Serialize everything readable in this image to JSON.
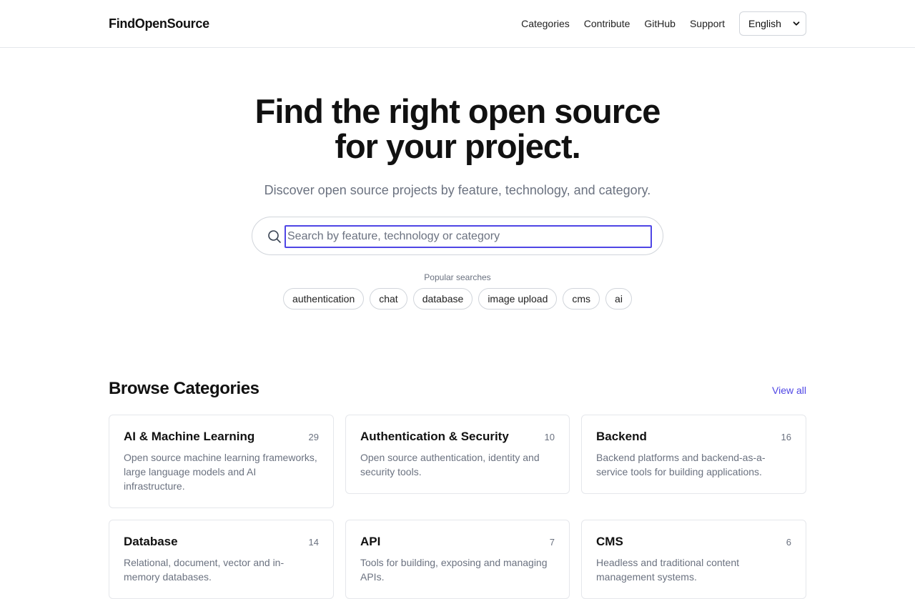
{
  "header": {
    "logo": "FindOpenSource",
    "nav": [
      "Categories",
      "Contribute",
      "GitHub",
      "Support"
    ],
    "language": "English"
  },
  "hero": {
    "title_line1": "Find the right open source",
    "title_line2": "for your project.",
    "subtitle": "Discover open source projects by feature, technology, and category."
  },
  "search": {
    "placeholder": "Search by feature, technology or category",
    "value": ""
  },
  "popular": {
    "label": "Popular searches",
    "chips": [
      "authentication",
      "chat",
      "database",
      "image upload",
      "cms",
      "ai"
    ]
  },
  "categories": {
    "title": "Browse Categories",
    "view_all": "View all",
    "items": [
      {
        "name": "AI & Machine Learning",
        "count": "29",
        "desc": "Open source machine learning frameworks, large language models and AI infrastructure."
      },
      {
        "name": "Authentication & Security",
        "count": "10",
        "desc": "Open source authentication, identity and security tools."
      },
      {
        "name": "Backend",
        "count": "16",
        "desc": "Backend platforms and backend-as-a-service tools for building applications."
      },
      {
        "name": "Database",
        "count": "14",
        "desc": "Relational, document, vector and in-memory databases."
      },
      {
        "name": "API",
        "count": "7",
        "desc": "Tools for building, exposing and managing APIs."
      },
      {
        "name": "CMS",
        "count": "6",
        "desc": "Headless and traditional content management systems."
      }
    ]
  }
}
